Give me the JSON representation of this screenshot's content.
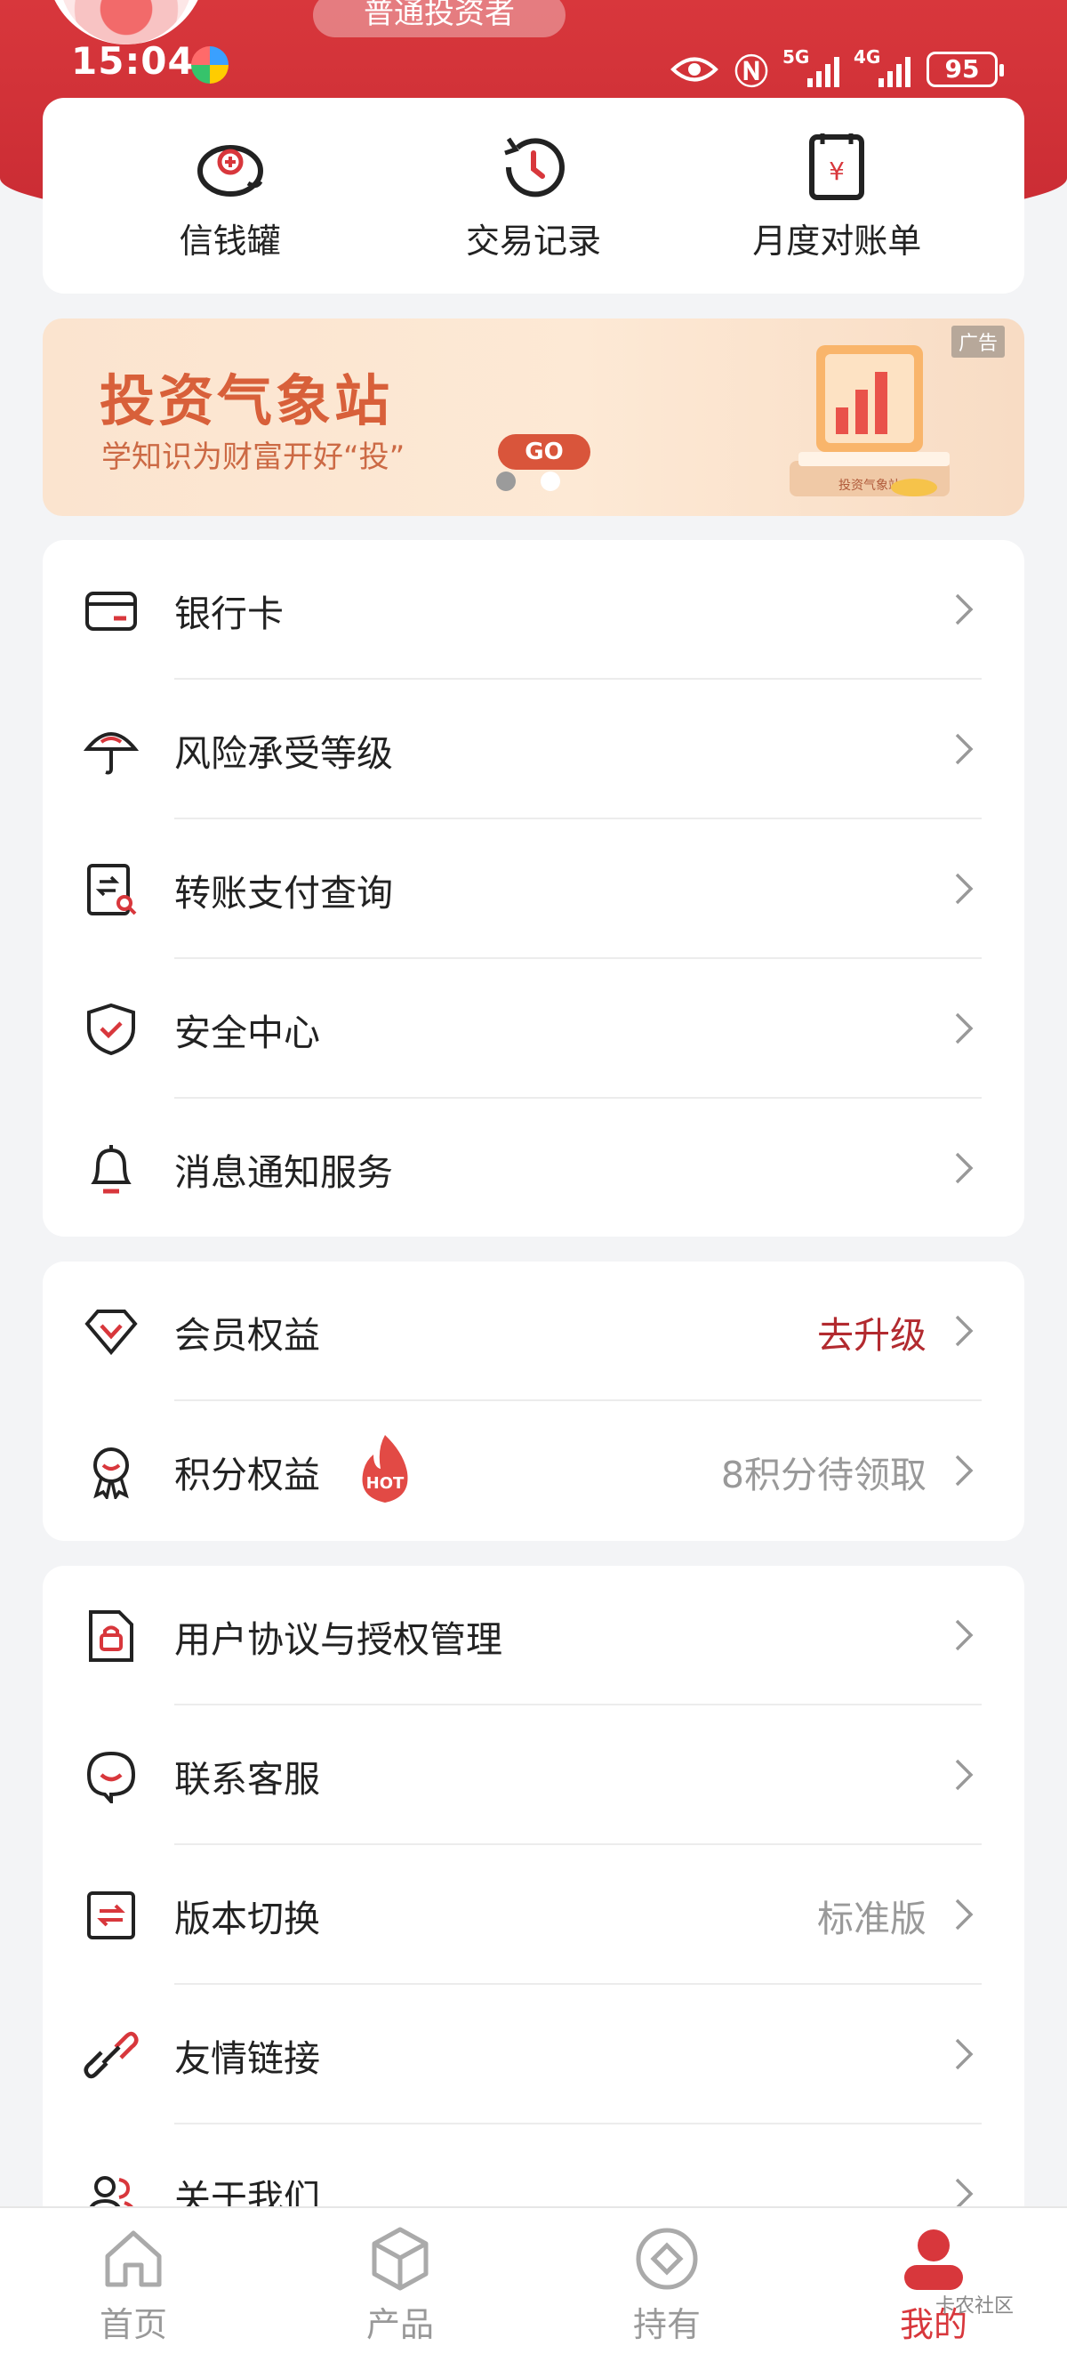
{
  "status_bar": {
    "time": "15:04",
    "network_1": "5G",
    "network_2": "4G",
    "battery": "95"
  },
  "profile": {
    "investor_level": "普通投资者"
  },
  "quick_actions": [
    {
      "label": "信钱罐",
      "icon": "piggy-bank-icon"
    },
    {
      "label": "交易记录",
      "icon": "history-clock-icon"
    },
    {
      "label": "月度对账单",
      "icon": "statement-icon"
    }
  ],
  "banner": {
    "title": "投资气象站",
    "subtitle": "学知识为财富开好“投”",
    "cta": "GO",
    "ad_tag": "广告",
    "book_text": "投资气象站"
  },
  "menu_group_1": [
    {
      "label": "银行卡",
      "icon": "bank-card-icon"
    },
    {
      "label": "风险承受等级",
      "icon": "umbrella-icon"
    },
    {
      "label": "转账支付查询",
      "icon": "transfer-search-icon"
    },
    {
      "label": "安全中心",
      "icon": "shield-check-icon"
    },
    {
      "label": "消息通知服务",
      "icon": "bell-icon"
    }
  ],
  "menu_group_2": [
    {
      "label": "会员权益",
      "value": "去升级",
      "icon": "diamond-icon"
    },
    {
      "label": "积分权益",
      "value": "8积分待领取",
      "badge": "HOT",
      "icon": "medal-icon"
    }
  ],
  "menu_group_3": [
    {
      "label": "用户协议与授权管理",
      "icon": "lock-document-icon"
    },
    {
      "label": "联系客服",
      "icon": "customer-service-icon"
    },
    {
      "label": "版本切换",
      "value": "标准版",
      "icon": "switch-icon"
    },
    {
      "label": "友情链接",
      "icon": "link-icon"
    },
    {
      "label": "关于我们",
      "icon": "users-icon"
    }
  ],
  "tabbar": [
    {
      "label": "首页",
      "icon": "home-icon"
    },
    {
      "label": "产品",
      "icon": "cube-icon"
    },
    {
      "label": "持有",
      "icon": "holding-icon"
    },
    {
      "label": "我的",
      "icon": "profile-icon"
    }
  ],
  "watermark": "卡农社区",
  "colors": {
    "brand_red": "#d8373c",
    "accent_red_text": "#b22a2f",
    "banner_orange": "#d8603a"
  }
}
